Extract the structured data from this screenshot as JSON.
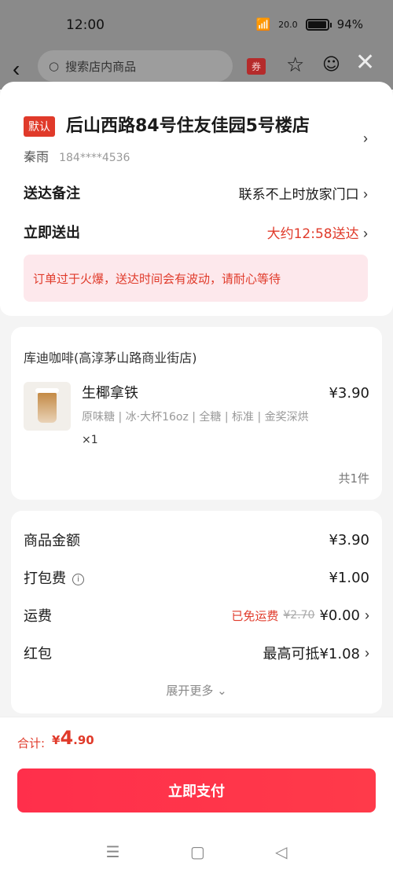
{
  "status_bar": {
    "time": "12:00",
    "net_speed": "20.0",
    "battery": "94%"
  },
  "header": {
    "search_placeholder": "搜索店内商品",
    "coupon_label": "券"
  },
  "address": {
    "default_tag": "默认",
    "title": "后山西路84号住友佳园5号楼店",
    "name": "秦雨",
    "phone": "184****4536"
  },
  "delivery": {
    "note_label": "送达备注",
    "note_value": "联系不上时放家门口",
    "time_label": "立即送出",
    "time_value": "大约12:58送达",
    "notice": "订单过于火爆，送达时间会有波动，请耐心等待"
  },
  "order": {
    "shop_name": "库迪咖啡(高淳茅山路商业街店)",
    "item": {
      "name": "生椰拿铁",
      "price": "¥3.90",
      "spec": "原味糖 | 冰·大杯16oz | 全糖 | 标准 | 金奖深烘",
      "qty": "×1"
    },
    "total_count": "共1件"
  },
  "fees": {
    "goods_label": "商品金额",
    "goods_value": "¥3.90",
    "packing_label": "打包费",
    "packing_value": "¥1.00",
    "shipping_label": "运费",
    "shipping_free": "已免运费",
    "shipping_original": "¥2.70",
    "shipping_value": "¥0.00",
    "redpack_label": "红包",
    "redpack_value": "最高可抵¥1.08",
    "expand_label": "展开更多"
  },
  "total": {
    "label": "合计:",
    "currency": "¥",
    "integer": "4",
    "decimal": ".90"
  },
  "pay_button": "立即支付"
}
